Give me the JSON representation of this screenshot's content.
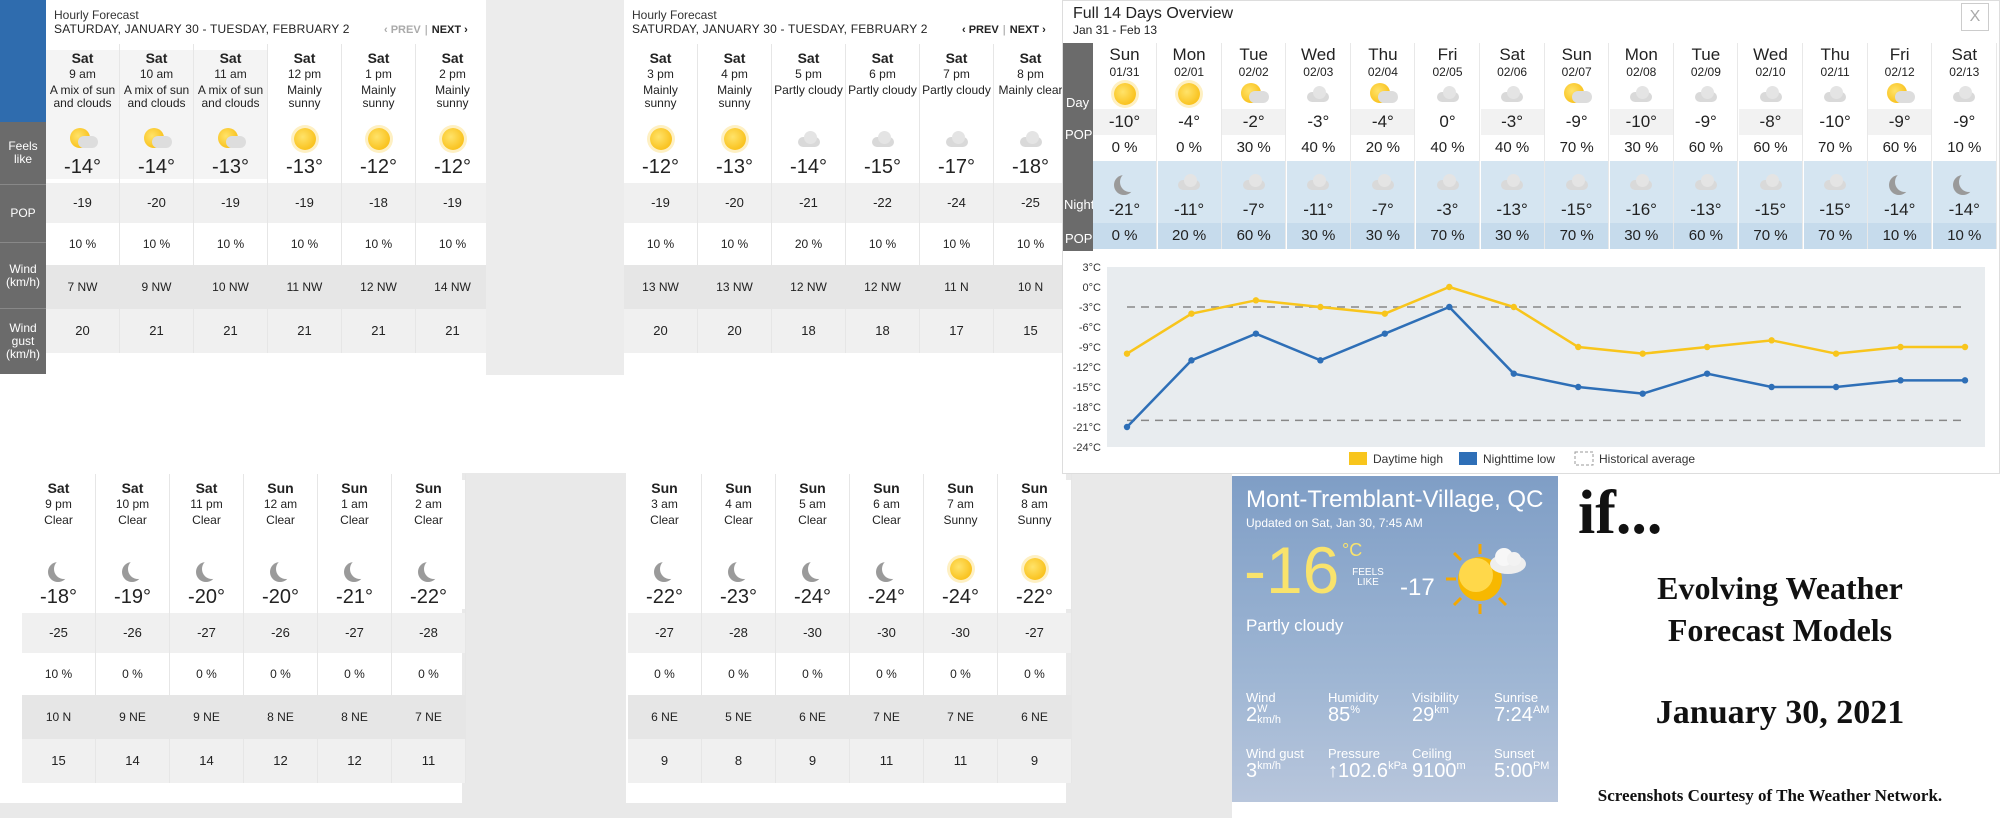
{
  "hourly_p1": {
    "title": "Hourly Forecast",
    "range": "SATURDAY, JANUARY 30 - TUESDAY, FEBRUARY 2",
    "prev": "‹ PREV",
    "next": "NEXT ›",
    "row_labels": [
      "Feels like",
      "POP",
      "Wind (km/h)",
      "Wind gust (km/h)"
    ],
    "cols": [
      {
        "day": "Sat",
        "time": "9 am",
        "cond": "A mix of sun and clouds",
        "icon": "partly-sunny-icon",
        "temp": "-14°",
        "feels": "-19",
        "pop": "10 %",
        "wind": "7 NW",
        "gust": "20"
      },
      {
        "day": "Sat",
        "time": "10 am",
        "cond": "A mix of sun and clouds",
        "icon": "partly-sunny-icon",
        "temp": "-14°",
        "feels": "-20",
        "pop": "10 %",
        "wind": "9 NW",
        "gust": "21"
      },
      {
        "day": "Sat",
        "time": "11 am",
        "cond": "A mix of sun and clouds",
        "icon": "partly-sunny-icon",
        "temp": "-13°",
        "feels": "-19",
        "pop": "10 %",
        "wind": "10 NW",
        "gust": "21"
      },
      {
        "day": "Sat",
        "time": "12 pm",
        "cond": "Mainly sunny",
        "icon": "sun-icon",
        "temp": "-13°",
        "feels": "-19",
        "pop": "10 %",
        "wind": "11 NW",
        "gust": "21"
      },
      {
        "day": "Sat",
        "time": "1 pm",
        "cond": "Mainly sunny",
        "icon": "sun-icon",
        "temp": "-12°",
        "feels": "-18",
        "pop": "10 %",
        "wind": "12 NW",
        "gust": "21"
      },
      {
        "day": "Sat",
        "time": "2 pm",
        "cond": "Mainly sunny",
        "icon": "sun-icon",
        "temp": "-12°",
        "feels": "-19",
        "pop": "10 %",
        "wind": "14 NW",
        "gust": "21"
      }
    ]
  },
  "hourly_p2": {
    "title": "Hourly Forecast",
    "range": "SATURDAY, JANUARY 30 - TUESDAY, FEBRUARY 2",
    "prev": "‹ PREV",
    "next": "NEXT ›",
    "cols": [
      {
        "day": "Sat",
        "time": "3 pm",
        "cond": "Mainly sunny",
        "icon": "sun-icon",
        "temp": "-12°",
        "feels": "-19",
        "pop": "10 %",
        "wind": "13 NW",
        "gust": "20"
      },
      {
        "day": "Sat",
        "time": "4 pm",
        "cond": "Mainly sunny",
        "icon": "sun-icon",
        "temp": "-13°",
        "feels": "-20",
        "pop": "10 %",
        "wind": "13 NW",
        "gust": "20"
      },
      {
        "day": "Sat",
        "time": "5 pm",
        "cond": "Partly cloudy",
        "icon": "cloud-icon",
        "temp": "-14°",
        "feels": "-21",
        "pop": "20 %",
        "wind": "12 NW",
        "gust": "18"
      },
      {
        "day": "Sat",
        "time": "6 pm",
        "cond": "Partly cloudy",
        "icon": "cloud-icon",
        "temp": "-15°",
        "feels": "-22",
        "pop": "10 %",
        "wind": "12 NW",
        "gust": "18"
      },
      {
        "day": "Sat",
        "time": "7 pm",
        "cond": "Partly cloudy",
        "icon": "cloud-icon",
        "temp": "-17°",
        "feels": "-24",
        "pop": "10 %",
        "wind": "11 N",
        "gust": "17"
      },
      {
        "day": "Sat",
        "time": "8 pm",
        "cond": "Mainly clear",
        "icon": "cloud-icon",
        "temp": "-18°",
        "feels": "-25",
        "pop": "10 %",
        "wind": "10 N",
        "gust": "15"
      }
    ]
  },
  "hourly_p3": {
    "cols": [
      {
        "day": "Sat",
        "time": "9 pm",
        "cond": "Clear",
        "temp": "-18°",
        "feels": "-25",
        "pop": "10 %",
        "wind": "10 N",
        "gust": "15"
      },
      {
        "day": "Sat",
        "time": "10 pm",
        "cond": "Clear",
        "temp": "-19°",
        "feels": "-26",
        "pop": "0 %",
        "wind": "9 NE",
        "gust": "14"
      },
      {
        "day": "Sat",
        "time": "11 pm",
        "cond": "Clear",
        "temp": "-20°",
        "feels": "-27",
        "pop": "0 %",
        "wind": "9 NE",
        "gust": "14"
      },
      {
        "day": "Sun",
        "time": "12 am",
        "cond": "Clear",
        "temp": "-20°",
        "feels": "-26",
        "pop": "0 %",
        "wind": "8 NE",
        "gust": "12"
      },
      {
        "day": "Sun",
        "time": "1 am",
        "cond": "Clear",
        "temp": "-21°",
        "feels": "-27",
        "pop": "0 %",
        "wind": "8 NE",
        "gust": "12"
      },
      {
        "day": "Sun",
        "time": "2 am",
        "cond": "Clear",
        "temp": "-22°",
        "feels": "-28",
        "pop": "0 %",
        "wind": "7 NE",
        "gust": "11"
      }
    ]
  },
  "hourly_p4": {
    "cols": [
      {
        "day": "Sun",
        "time": "3 am",
        "cond": "Clear",
        "icon": "moon-icon",
        "temp": "-22°",
        "feels": "-27",
        "pop": "0 %",
        "wind": "6 NE",
        "gust": "9"
      },
      {
        "day": "Sun",
        "time": "4 am",
        "cond": "Clear",
        "icon": "moon-icon",
        "temp": "-23°",
        "feels": "-28",
        "pop": "0 %",
        "wind": "5 NE",
        "gust": "8"
      },
      {
        "day": "Sun",
        "time": "5 am",
        "cond": "Clear",
        "icon": "moon-icon",
        "temp": "-24°",
        "feels": "-30",
        "pop": "0 %",
        "wind": "6 NE",
        "gust": "9"
      },
      {
        "day": "Sun",
        "time": "6 am",
        "cond": "Clear",
        "icon": "moon-icon",
        "temp": "-24°",
        "feels": "-30",
        "pop": "0 %",
        "wind": "7 NE",
        "gust": "11"
      },
      {
        "day": "Sun",
        "time": "7 am",
        "cond": "Sunny",
        "icon": "sun-icon",
        "temp": "-24°",
        "feels": "-30",
        "pop": "0 %",
        "wind": "7 NE",
        "gust": "11"
      },
      {
        "day": "Sun",
        "time": "8 am",
        "cond": "Sunny",
        "icon": "sun-icon",
        "temp": "-22°",
        "feels": "-27",
        "pop": "0 %",
        "wind": "6 NE",
        "gust": "9"
      }
    ]
  },
  "overview": {
    "title": "Full 14 Days Overview",
    "range": "Jan 31 - Feb 13",
    "close": "X",
    "labels": {
      "day": "Day",
      "pop": "POP",
      "night": "Night",
      "npop": "POP"
    },
    "days": [
      {
        "d": "Sun",
        "date": "01/31",
        "hi": "-10°",
        "pop": "0 %",
        "lo": "-21°",
        "npop": "0 %",
        "dicon": "sun-icon",
        "nicon": "moon-icon"
      },
      {
        "d": "Mon",
        "date": "02/01",
        "hi": "-4°",
        "pop": "0 %",
        "lo": "-11°",
        "npop": "20 %",
        "dicon": "sun-icon",
        "nicon": "cloud-icon"
      },
      {
        "d": "Tue",
        "date": "02/02",
        "hi": "-2°",
        "pop": "30 %",
        "lo": "-7°",
        "npop": "60 %",
        "dicon": "partly-sunny-icon",
        "nicon": "cloud-icon"
      },
      {
        "d": "Wed",
        "date": "02/03",
        "hi": "-3°",
        "pop": "40 %",
        "lo": "-11°",
        "npop": "30 %",
        "dicon": "cloud-icon",
        "nicon": "cloud-icon"
      },
      {
        "d": "Thu",
        "date": "02/04",
        "hi": "-4°",
        "pop": "20 %",
        "lo": "-7°",
        "npop": "30 %",
        "dicon": "partly-sunny-icon",
        "nicon": "cloud-icon"
      },
      {
        "d": "Fri",
        "date": "02/05",
        "hi": "0°",
        "pop": "40 %",
        "lo": "-3°",
        "npop": "70 %",
        "dicon": "cloud-icon",
        "nicon": "cloud-icon"
      },
      {
        "d": "Sat",
        "date": "02/06",
        "hi": "-3°",
        "pop": "40 %",
        "lo": "-13°",
        "npop": "30 %",
        "dicon": "cloud-icon",
        "nicon": "cloud-icon"
      },
      {
        "d": "Sun",
        "date": "02/07",
        "hi": "-9°",
        "pop": "70 %",
        "lo": "-15°",
        "npop": "70 %",
        "dicon": "partly-sunny-icon",
        "nicon": "cloud-icon"
      },
      {
        "d": "Mon",
        "date": "02/08",
        "hi": "-10°",
        "pop": "30 %",
        "lo": "-16°",
        "npop": "30 %",
        "dicon": "cloud-icon",
        "nicon": "cloud-icon"
      },
      {
        "d": "Tue",
        "date": "02/09",
        "hi": "-9°",
        "pop": "60 %",
        "lo": "-13°",
        "npop": "60 %",
        "dicon": "cloud-icon",
        "nicon": "cloud-icon"
      },
      {
        "d": "Wed",
        "date": "02/10",
        "hi": "-8°",
        "pop": "60 %",
        "lo": "-15°",
        "npop": "70 %",
        "dicon": "cloud-icon",
        "nicon": "cloud-icon"
      },
      {
        "d": "Thu",
        "date": "02/11",
        "hi": "-10°",
        "pop": "70 %",
        "lo": "-15°",
        "npop": "70 %",
        "dicon": "cloud-icon",
        "nicon": "cloud-icon"
      },
      {
        "d": "Fri",
        "date": "02/12",
        "hi": "-9°",
        "pop": "60 %",
        "lo": "-14°",
        "npop": "10 %",
        "dicon": "partly-sunny-icon",
        "nicon": "moon-icon"
      },
      {
        "d": "Sat",
        "date": "02/13",
        "hi": "-9°",
        "pop": "10 %",
        "lo": "-14°",
        "npop": "10 %",
        "dicon": "cloud-icon",
        "nicon": "moon-icon"
      }
    ]
  },
  "chart_data": {
    "type": "line",
    "x": [
      "01/31",
      "02/01",
      "02/02",
      "02/03",
      "02/04",
      "02/05",
      "02/06",
      "02/07",
      "02/08",
      "02/09",
      "02/10",
      "02/11",
      "02/12",
      "02/13"
    ],
    "series": [
      {
        "name": "Daytime high",
        "color": "#f8c51c",
        "values": [
          -10,
          -4,
          -2,
          -3,
          -4,
          0,
          -3,
          -9,
          -10,
          -9,
          -8,
          -10,
          -9,
          -9
        ]
      },
      {
        "name": "Nighttime low",
        "color": "#2e6fb7",
        "values": [
          -21,
          -11,
          -7,
          -11,
          -7,
          -3,
          -13,
          -15,
          -16,
          -13,
          -15,
          -15,
          -14,
          -14
        ]
      },
      {
        "name": "Historical average",
        "values_high": -3,
        "values_low": -20
      }
    ],
    "y_ticks": [
      "3°C",
      "0°C",
      "-3°C",
      "-6°C",
      "-9°C",
      "-12°C",
      "-15°C",
      "-18°C",
      "-21°C",
      "-24°C"
    ],
    "ylim": [
      -24,
      3
    ],
    "legend_position": "bottom"
  },
  "current": {
    "city": "Mont-Tremblant-Village, QC",
    "updated": "Updated on Sat, Jan 30, 7:45 AM",
    "temp": "-16",
    "unit": "°C",
    "feels_label": "FEELS LIKE",
    "feels": "-17",
    "cond": "Partly cloudy",
    "wind_k": "Wind",
    "wind_v": "2",
    "wind_dir": "W",
    "wind_u": "km/h",
    "hum_k": "Humidity",
    "hum_v": "85",
    "hum_u": "%",
    "vis_k": "Visibility",
    "vis_v": "29",
    "vis_u": "km",
    "sunrise_k": "Sunrise",
    "sunrise_v": "7:24",
    "sunrise_u": "AM",
    "gust_k": "Wind gust",
    "gust_v": "3",
    "gust_u": "km/h",
    "press_k": "Pressure",
    "press_v": "↑102.6",
    "press_u": "kPa",
    "ceil_k": "Ceiling",
    "ceil_v": "9100",
    "ceil_u": "m",
    "sunset_k": "Sunset",
    "sunset_v": "5:00",
    "sunset_u": "PM"
  },
  "caption": {
    "if": "if...",
    "line1": "Evolving Weather",
    "line2": "Forecast Models",
    "date": "January 30, 2021",
    "credit": "Screenshots Courtesy of The Weather Network."
  }
}
